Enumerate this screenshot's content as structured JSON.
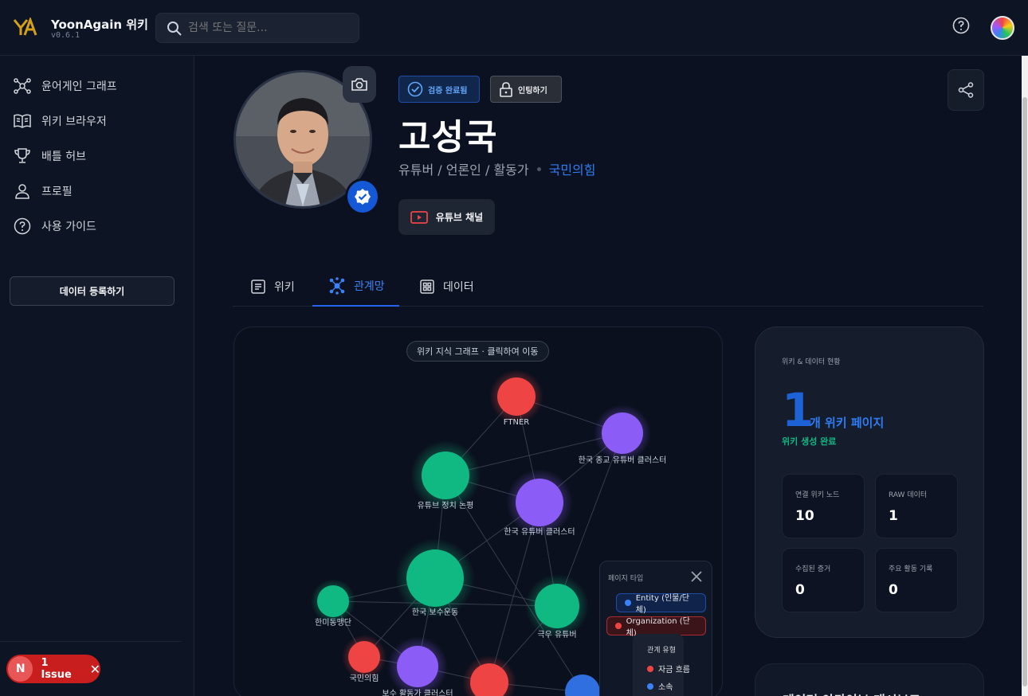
{
  "app": {
    "title": "YoonAgain 위키",
    "version": "v0.6.1"
  },
  "search": {
    "placeholder": "검색 또는 질문..."
  },
  "sidebar": {
    "items": [
      {
        "label": "윤어게인 그래프",
        "icon": "graph-icon"
      },
      {
        "label": "위키 브라우저",
        "icon": "book-icon"
      },
      {
        "label": "배틀 허브",
        "icon": "trophy-icon"
      },
      {
        "label": "프로필",
        "icon": "user-icon"
      },
      {
        "label": "사용 가이드",
        "icon": "help-icon"
      }
    ],
    "register_label": "데이터 등록하기"
  },
  "issue": {
    "avatar_letter": "N",
    "label": "1 Issue"
  },
  "profile": {
    "verified_label": "검증 완료됨",
    "lock_label": "인팅하기",
    "name": "고성국",
    "roles": "유튜버 / 언론인 / 활동가",
    "party": "국민의힘",
    "youtube_label": "유튜브 채널"
  },
  "tabs": [
    {
      "label": "위키",
      "icon": "document-icon",
      "active": false
    },
    {
      "label": "관계망",
      "icon": "network-icon",
      "active": true
    },
    {
      "label": "데이터",
      "icon": "grid-icon",
      "active": false
    }
  ],
  "graph": {
    "pill": "위키 지식 그래프 · 클릭하여 이동",
    "nodes": [
      {
        "label": "FTNER",
        "type": "organization"
      },
      {
        "label": "한국 종교 유튜버 클러스터",
        "type": "cluster"
      },
      {
        "label": "유튜브 정치 논평",
        "type": "topic"
      },
      {
        "label": "한국 유튜버 클러스터",
        "type": "cluster"
      },
      {
        "label": "한국 보수운동",
        "type": "topic"
      },
      {
        "label": "한미동맹단",
        "type": "topic"
      },
      {
        "label": "극우 유튜버",
        "type": "topic"
      },
      {
        "label": "국민의힘",
        "type": "organization"
      },
      {
        "label": "보수 활동가 클러스터",
        "type": "cluster"
      }
    ],
    "legend": {
      "title": "페이지 타입",
      "chips": [
        {
          "label": "Entity (인물/단체)",
          "color": "#3b82f6"
        },
        {
          "label": "Organization (단체)",
          "color": "#ef4444"
        }
      ],
      "relation_title": "관계 유형",
      "relations": [
        {
          "label": "자금 흐름",
          "color": "#ef4444"
        },
        {
          "label": "소속",
          "color": "#3b82f6"
        }
      ]
    },
    "colors": {
      "organization": "#ef4444",
      "cluster": "#8b5cf6",
      "topic": "#10b981",
      "entity": "#3b82f6"
    }
  },
  "stats": {
    "heading": "위키 & 데이터 현황",
    "count": "1",
    "count_unit": "개 위키 페이지",
    "status": "위키 생성 완료",
    "items": [
      {
        "label": "연결 위키 노드",
        "value": "10"
      },
      {
        "label": "RAW 데이터",
        "value": "1"
      },
      {
        "label": "수집된 증거",
        "value": "0"
      },
      {
        "label": "주요 활동 기록",
        "value": "0"
      }
    ]
  },
  "next_section": {
    "title": "데이터 아카이브 대시보드"
  }
}
